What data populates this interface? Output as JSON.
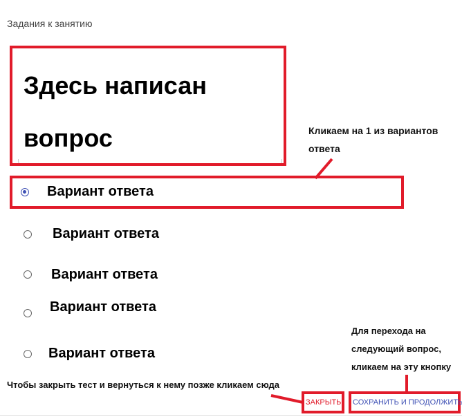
{
  "section": {
    "title": "Задания к занятию"
  },
  "question": {
    "text": "Здесь написан вопрос"
  },
  "options": [
    {
      "label": "Вариант ответа",
      "selected": true
    },
    {
      "label": "Вариант ответа",
      "selected": false
    },
    {
      "label": "Вариант ответа",
      "selected": false
    },
    {
      "label": "Вариант ответа",
      "selected": false
    },
    {
      "label": "Вариант ответа",
      "selected": false
    }
  ],
  "annotations": {
    "pick_answer": "Кликаем на 1 из вариантов ответа",
    "next_question": "Для перехода на следующий вопрос, кликаем на эту кнопку",
    "close_test": "Чтобы закрыть тест и вернуться к нему позже кликаем сюда"
  },
  "buttons": {
    "close_label": "ЗАКРЫТЬ",
    "save_continue_label": "СОХРАНИТЬ И ПРОДОЛЖИТЬ"
  },
  "colors": {
    "highlight_red": "#e11b2a",
    "accent_blue": "#3f51b5",
    "close_text": "#e11b2a",
    "save_text": "#3f51b5"
  }
}
